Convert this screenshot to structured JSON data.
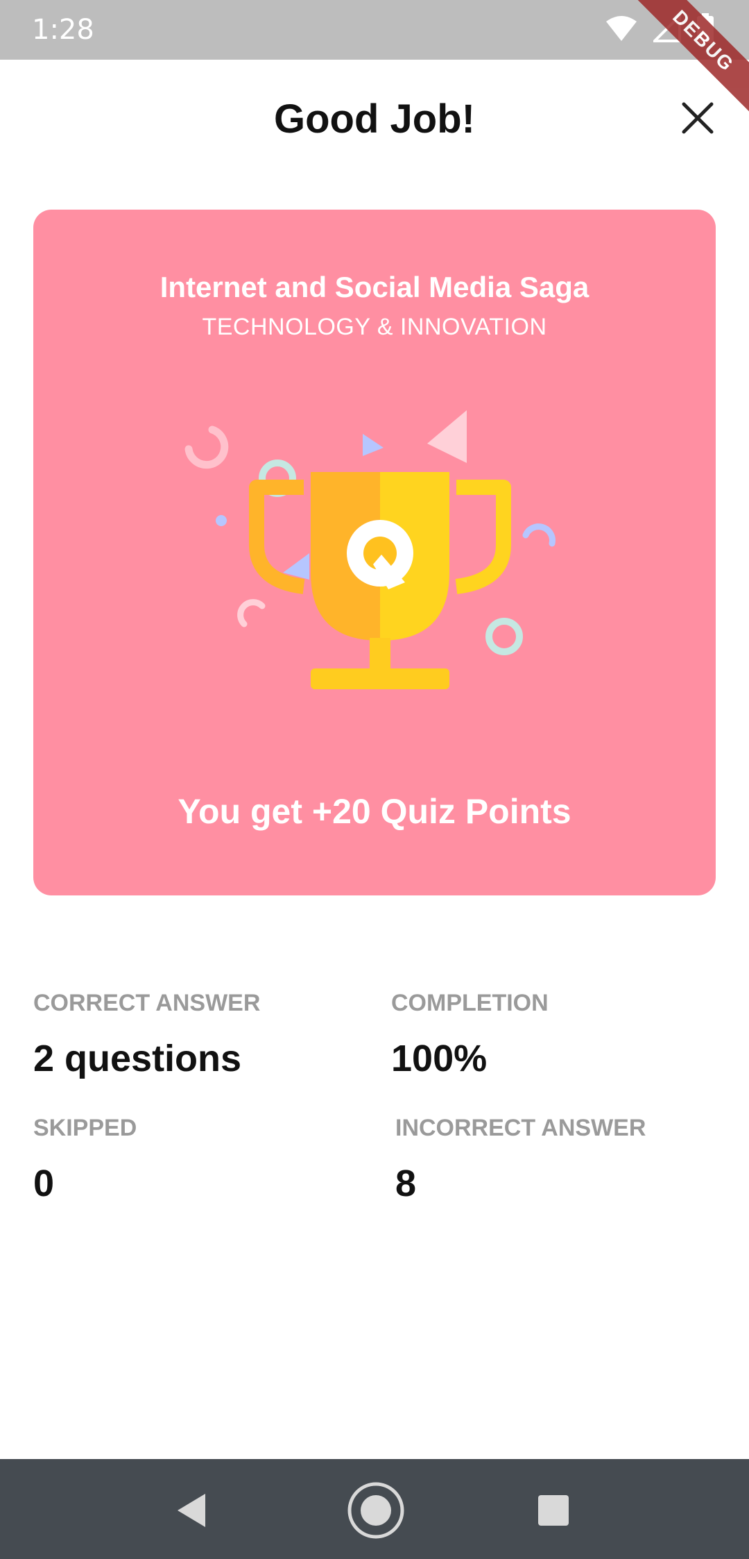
{
  "status_bar": {
    "time": "1:28",
    "battery_level": "75",
    "debug_label": "DEBUG",
    "icons": [
      "wifi-icon",
      "signal-icon",
      "battery-icon"
    ]
  },
  "header": {
    "title": "Good Job!",
    "close_icon": "close-icon"
  },
  "result_card": {
    "background_color": "#ff8fa2",
    "quiz_title": "Internet and Social Media Saga",
    "category": "TECHNOLOGY & INNOVATION",
    "illustration": "trophy-icon",
    "points_text": "You get +20 Quiz Points"
  },
  "stats": {
    "correct_label": "CORRECT ANSWER",
    "correct_value": "2 questions",
    "completion_label": "COMPLETION",
    "completion_value": "100%",
    "skipped_label": "SKIPPED",
    "skipped_value": "0",
    "incorrect_label": "INCORRECT ANSWER",
    "incorrect_value": "8"
  },
  "nav_bar": {
    "icons": [
      "back-icon",
      "home-icon",
      "recents-icon"
    ]
  }
}
